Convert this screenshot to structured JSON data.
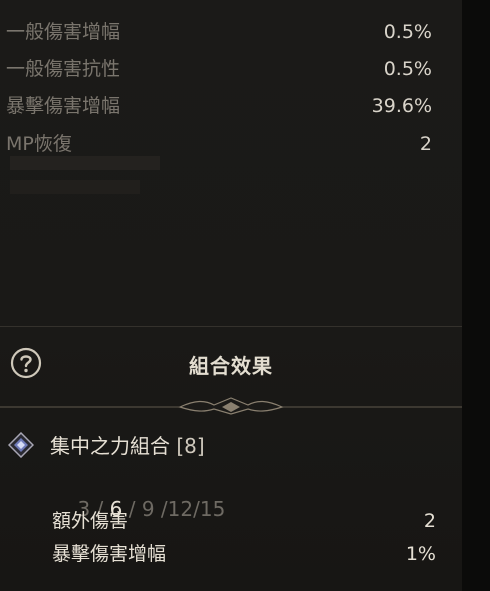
{
  "stats": [
    {
      "label": "一般傷害增幅",
      "value": "0.5%"
    },
    {
      "label": "一般傷害抗性",
      "value": "0.5%"
    },
    {
      "label": "暴擊傷害增幅",
      "value": "39.6%"
    },
    {
      "label": "MP恢復",
      "value": "2"
    }
  ],
  "combo": {
    "section_title": "組合效果",
    "set_name": "集中之力組合",
    "set_count": "[8]",
    "tiers": [
      "3",
      "6",
      "9",
      "12",
      "15"
    ],
    "tier_separators": [
      " / ",
      " / ",
      " /",
      "/"
    ],
    "active_tier": "6",
    "bonuses": [
      {
        "label": "額外傷害",
        "value": "2"
      },
      {
        "label": "暴擊傷害增幅",
        "value": "1%"
      }
    ]
  },
  "colors": {
    "background": "#1a1917",
    "label": "#7a756d",
    "value": "#d9d4ca",
    "highlight": "#e6e0d4",
    "inactive_tier": "#6e6a63",
    "ornament": "#8a8070"
  },
  "icons": {
    "help": "question-circle-icon",
    "set": "diamond-gem-icon",
    "divider": "ornament-divider"
  }
}
